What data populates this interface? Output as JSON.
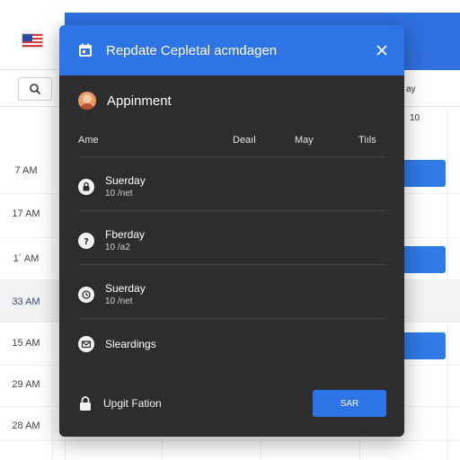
{
  "calendar": {
    "time_labels": [
      "7 AM",
      "17 AM",
      "1´ AM",
      "33 AM",
      "15 AM",
      "29 AM",
      "28 AM"
    ],
    "header_fragments": [
      "ay",
      "10"
    ]
  },
  "dialog": {
    "title": "Repdate Cepletal acmdagen",
    "subtitle": "Appinment",
    "columns": [
      "Ame",
      "Deaıl",
      "May",
      "Tiıls"
    ],
    "items": [
      {
        "name": "Suerday",
        "sub": "10 /net",
        "icon": "lock-icon"
      },
      {
        "name": "Fberday",
        "sub": "10 /a2",
        "icon": "info-icon"
      },
      {
        "name": "Suerday",
        "sub": "10 /net",
        "icon": "clock-icon"
      },
      {
        "name": "Sleardings",
        "sub": "",
        "icon": "envelope-icon"
      }
    ],
    "footer_label": "Upgit Fation",
    "save_label": "SAR"
  },
  "colors": {
    "accent": "#2f74e6",
    "dialog_bg": "#2d2d2f",
    "event_blue": "#2f7ae5"
  }
}
